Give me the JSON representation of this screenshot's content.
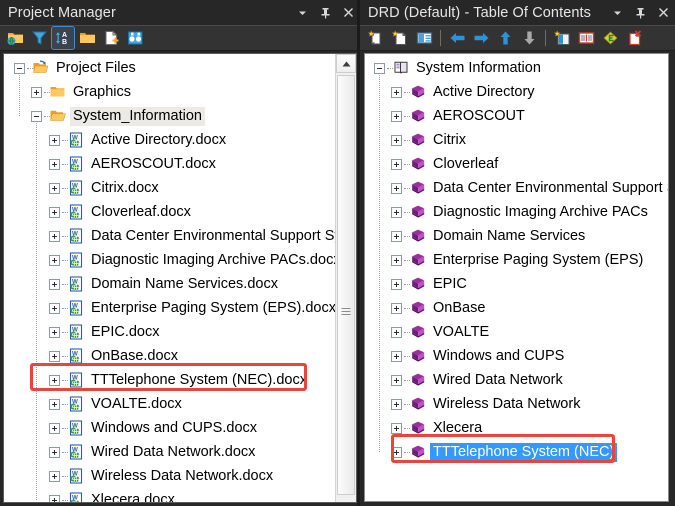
{
  "left_panel": {
    "title": "Project Manager",
    "title_buttons": [
      {
        "name": "dropdown-menu-button",
        "glyph": "chevron-down-icon"
      },
      {
        "name": "auto-hide-button",
        "glyph": "pin-icon"
      },
      {
        "name": "close-button",
        "glyph": "close-icon"
      }
    ],
    "toolbar": [
      {
        "name": "open-project-button",
        "icon": "folder-globe-icon",
        "selected": false
      },
      {
        "name": "filter-button",
        "icon": "funnel-icon",
        "selected": false
      },
      {
        "name": "sort-button",
        "icon": "sort-ab-icon",
        "selected": true
      },
      {
        "name": "new-folder-button",
        "icon": "folder-icon",
        "selected": false
      },
      {
        "name": "new-document-button",
        "icon": "document-plus-icon",
        "selected": false
      },
      {
        "name": "find-button",
        "icon": "binoculars-icon",
        "selected": false
      }
    ],
    "tree": [
      {
        "label": "Project Files",
        "depth": 0,
        "state": "minus",
        "icon": "open-folder-arrow-icon",
        "highlight": false
      },
      {
        "label": "Graphics",
        "depth": 1,
        "state": "plus",
        "icon": "folder-icon",
        "highlight": false
      },
      {
        "label": "System_Information",
        "depth": 1,
        "state": "minus",
        "icon": "open-folder-icon",
        "highlight": true
      },
      {
        "label": "Active Directory.docx",
        "depth": 2,
        "state": "plus",
        "icon": "word-doc-icon",
        "highlight": false
      },
      {
        "label": "AEROSCOUT.docx",
        "depth": 2,
        "state": "plus",
        "icon": "word-doc-icon",
        "highlight": false
      },
      {
        "label": "Citrix.docx",
        "depth": 2,
        "state": "plus",
        "icon": "word-doc-icon",
        "highlight": false
      },
      {
        "label": "Cloverleaf.docx",
        "depth": 2,
        "state": "plus",
        "icon": "word-doc-icon",
        "highlight": false
      },
      {
        "label": "Data Center Environmental Support Syste",
        "depth": 2,
        "state": "plus",
        "icon": "word-doc-icon",
        "highlight": false
      },
      {
        "label": "Diagnostic Imaging Archive PACs.docx",
        "depth": 2,
        "state": "plus",
        "icon": "word-doc-icon",
        "highlight": false
      },
      {
        "label": "Domain Name Services.docx",
        "depth": 2,
        "state": "plus",
        "icon": "word-doc-icon",
        "highlight": false
      },
      {
        "label": "Enterprise Paging System (EPS).docx",
        "depth": 2,
        "state": "plus",
        "icon": "word-doc-icon",
        "highlight": false
      },
      {
        "label": "EPIC.docx",
        "depth": 2,
        "state": "plus",
        "icon": "word-doc-icon",
        "highlight": false
      },
      {
        "label": "OnBase.docx",
        "depth": 2,
        "state": "plus",
        "icon": "word-doc-icon",
        "highlight": false
      },
      {
        "label": "TTTelephone System (NEC).docx",
        "depth": 2,
        "state": "plus",
        "icon": "word-doc-icon",
        "highlight": false
      },
      {
        "label": "VOALTE.docx",
        "depth": 2,
        "state": "plus",
        "icon": "word-doc-icon",
        "highlight": false
      },
      {
        "label": "Windows and CUPS.docx",
        "depth": 2,
        "state": "plus",
        "icon": "word-doc-icon",
        "highlight": false
      },
      {
        "label": "Wired Data Network.docx",
        "depth": 2,
        "state": "plus",
        "icon": "word-doc-icon",
        "highlight": false
      },
      {
        "label": "Wireless Data Network.docx",
        "depth": 2,
        "state": "plus",
        "icon": "word-doc-icon",
        "highlight": false
      },
      {
        "label": "Xlecera.docx",
        "depth": 2,
        "state": "plus",
        "icon": "word-doc-icon",
        "highlight": false
      }
    ]
  },
  "right_panel": {
    "title": "DRD (Default) - Table Of Contents",
    "title_buttons": [
      {
        "name": "dropdown-menu-button",
        "glyph": "chevron-down-icon"
      },
      {
        "name": "auto-hide-button",
        "glyph": "pin-icon"
      },
      {
        "name": "close-button",
        "glyph": "close-icon"
      }
    ],
    "toolbar": [
      {
        "name": "new-topic-button",
        "icon": "new-book-icon"
      },
      {
        "name": "new-page-button",
        "icon": "new-page-icon"
      },
      {
        "name": "properties-button",
        "icon": "table-icon"
      },
      {
        "name": "separator-1",
        "icon": "separator"
      },
      {
        "name": "move-left-button",
        "icon": "arrow-left-icon"
      },
      {
        "name": "move-right-button",
        "icon": "arrow-right-icon"
      },
      {
        "name": "move-up-button",
        "icon": "arrow-up-icon"
      },
      {
        "name": "move-down-button",
        "icon": "arrow-down-icon"
      },
      {
        "name": "separator-2",
        "icon": "separator"
      },
      {
        "name": "new-book-page-button",
        "icon": "book-page-icon"
      },
      {
        "name": "edit-entry-button",
        "icon": "red-book-icon"
      },
      {
        "name": "link-button",
        "icon": "green-diamond-icon"
      },
      {
        "name": "delete-button",
        "icon": "delete-page-icon"
      }
    ],
    "tree": [
      {
        "label": "System Information",
        "depth": 0,
        "state": "minus",
        "icon": "open-book-icon",
        "selected": false
      },
      {
        "label": "Active Directory",
        "depth": 1,
        "state": "plus",
        "icon": "purple-book-icon",
        "selected": false
      },
      {
        "label": "AEROSCOUT",
        "depth": 1,
        "state": "plus",
        "icon": "purple-book-icon",
        "selected": false
      },
      {
        "label": "Citrix",
        "depth": 1,
        "state": "plus",
        "icon": "purple-book-icon",
        "selected": false
      },
      {
        "label": "Cloverleaf",
        "depth": 1,
        "state": "plus",
        "icon": "purple-book-icon",
        "selected": false
      },
      {
        "label": "Data Center Environmental Support Sy",
        "depth": 1,
        "state": "plus",
        "icon": "purple-book-icon",
        "selected": false
      },
      {
        "label": "Diagnostic Imaging Archive PACs",
        "depth": 1,
        "state": "plus",
        "icon": "purple-book-icon",
        "selected": false
      },
      {
        "label": "Domain Name Services",
        "depth": 1,
        "state": "plus",
        "icon": "purple-book-icon",
        "selected": false
      },
      {
        "label": "Enterprise Paging System (EPS)",
        "depth": 1,
        "state": "plus",
        "icon": "purple-book-icon",
        "selected": false
      },
      {
        "label": "EPIC",
        "depth": 1,
        "state": "plus",
        "icon": "purple-book-icon",
        "selected": false
      },
      {
        "label": "OnBase",
        "depth": 1,
        "state": "plus",
        "icon": "purple-book-icon",
        "selected": false
      },
      {
        "label": "VOALTE",
        "depth": 1,
        "state": "plus",
        "icon": "purple-book-icon",
        "selected": false
      },
      {
        "label": "Windows and CUPS",
        "depth": 1,
        "state": "plus",
        "icon": "purple-book-icon",
        "selected": false
      },
      {
        "label": "Wired Data Network",
        "depth": 1,
        "state": "plus",
        "icon": "purple-book-icon",
        "selected": false
      },
      {
        "label": "Wireless Data Network",
        "depth": 1,
        "state": "plus",
        "icon": "purple-book-icon",
        "selected": false
      },
      {
        "label": "Xlecera",
        "depth": 1,
        "state": "plus",
        "icon": "purple-book-icon",
        "selected": false
      },
      {
        "label": "TTTelephone System (NEC)",
        "depth": 1,
        "state": "plus",
        "icon": "purple-book-icon",
        "selected": true
      }
    ]
  },
  "annotations": [
    {
      "name": "highlight-box-left",
      "target": "TTTelephone System (NEC).docx",
      "color": "#e8453c"
    },
    {
      "name": "highlight-box-right",
      "target": "TTTelephone System (NEC)",
      "color": "#e8453c"
    }
  ],
  "colors": {
    "titlebar_bg": "#272727",
    "toolbar_bg": "#333333",
    "tree_bg": "#ffffff",
    "selection_blue": "#3399ff",
    "row_highlight": "#eceae4",
    "annotation_red": "#e8453c"
  },
  "scrollbar": {
    "name": "left-tree-vertical-scrollbar",
    "orientation": "vertical"
  }
}
